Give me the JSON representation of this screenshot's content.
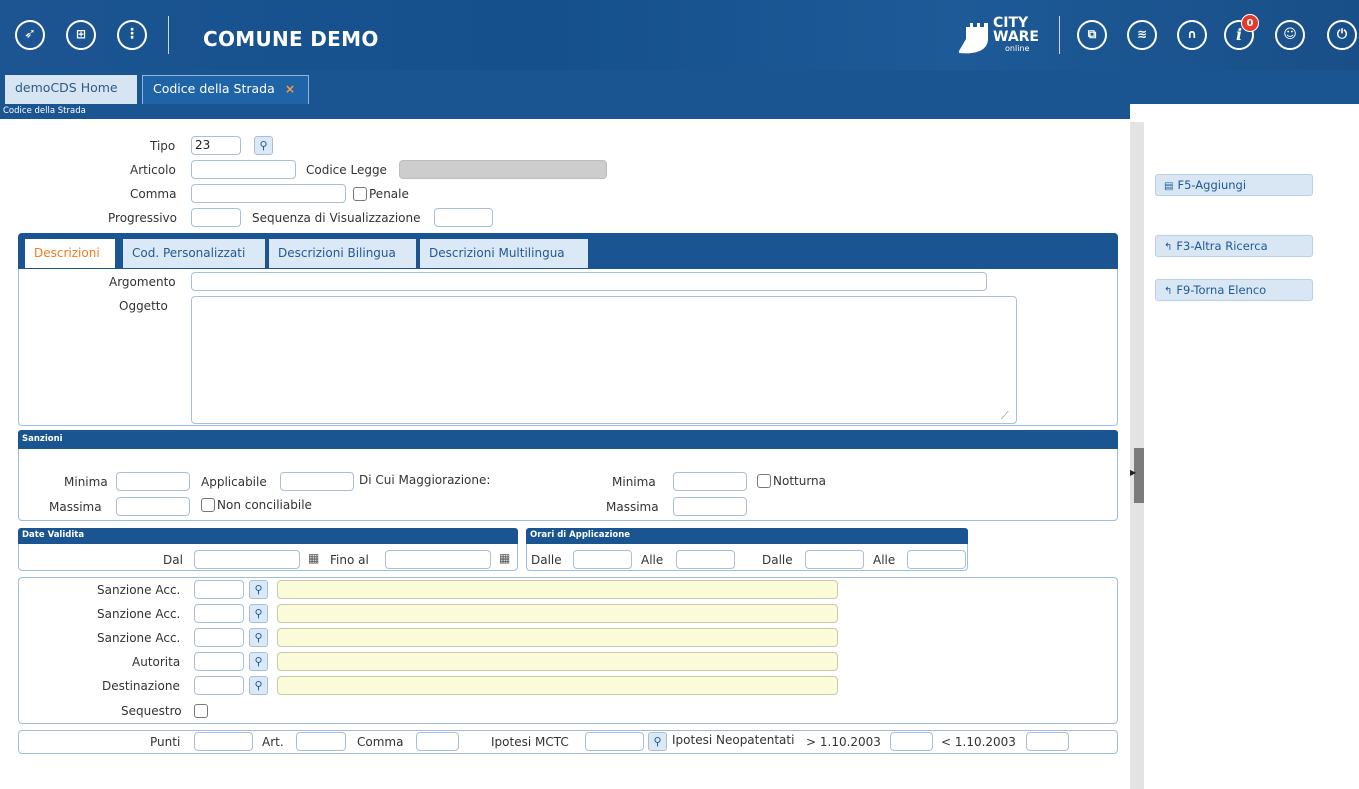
{
  "header": {
    "title": "COMUNE DEMO",
    "brand_line1": "CITY",
    "brand_line2": "WARE",
    "brand_line3": "online",
    "info_badge": "0",
    "icons_left": [
      "rocket-icon",
      "grid-icon",
      "more-vertical-icon"
    ],
    "icons_right": [
      "windows-icon",
      "layers-icon",
      "headset-icon",
      "info-icon",
      "user-icon",
      "power-icon"
    ]
  },
  "tabs": [
    {
      "label": "demoCDS Home"
    },
    {
      "label": "Codice della Strada",
      "close": "×"
    }
  ],
  "breadcrumb": "Codice della Strada",
  "form": {
    "tipo_label": "Tipo",
    "tipo_value": "23",
    "articolo_label": "Articolo",
    "codice_legge_label": "Codice Legge",
    "comma_label": "Comma",
    "penale_label": "Penale",
    "progressivo_label": "Progressivo",
    "sequenza_label": "Sequenza di Visualizzazione"
  },
  "inner_tabs": [
    "Descrizioni",
    "Cod. Personalizzati",
    "Descrizioni Bilingua",
    "Descrizioni Multilingua"
  ],
  "descr": {
    "argomento_label": "Argomento",
    "oggetto_label": "Oggetto"
  },
  "sanzioni": {
    "title": "Sanzioni",
    "minima": "Minima",
    "applicabile": "Applicabile",
    "di_cui": "Di Cui Maggiorazione:",
    "minima2": "Minima",
    "notturna": "Notturna",
    "massima": "Massima",
    "non_conciliabile": "Non conciliabile",
    "massima2": "Massima"
  },
  "date_validita": {
    "title": "Date Validita",
    "dal": "Dal",
    "fino_al": "Fino al"
  },
  "orari": {
    "title": "Orari di Applicazione",
    "dalle1": "Dalle",
    "alle1": "Alle",
    "dalle2": "Dalle",
    "alle2": "Alle"
  },
  "lookups": {
    "rows": [
      "Sanzione Acc.",
      "Sanzione Acc.",
      "Sanzione Acc.",
      "Autorita",
      "Destinazione"
    ],
    "sequestro": "Sequestro"
  },
  "bottom": {
    "punti": "Punti",
    "art": "Art.",
    "comma": "Comma",
    "ipotesi_mctc": "Ipotesi MCTC",
    "ipotesi_neo": "Ipotesi Neopatentati",
    "gt": "> 1.10.2003",
    "lt": "< 1.10.2003"
  },
  "actions": [
    {
      "label": "F5-Aggiungi",
      "icon": "save-icon"
    },
    {
      "label": "F3-Altra Ricerca",
      "icon": "back-arrow-icon"
    },
    {
      "label": "F9-Torna Elenco",
      "icon": "back-arrow-icon"
    }
  ]
}
